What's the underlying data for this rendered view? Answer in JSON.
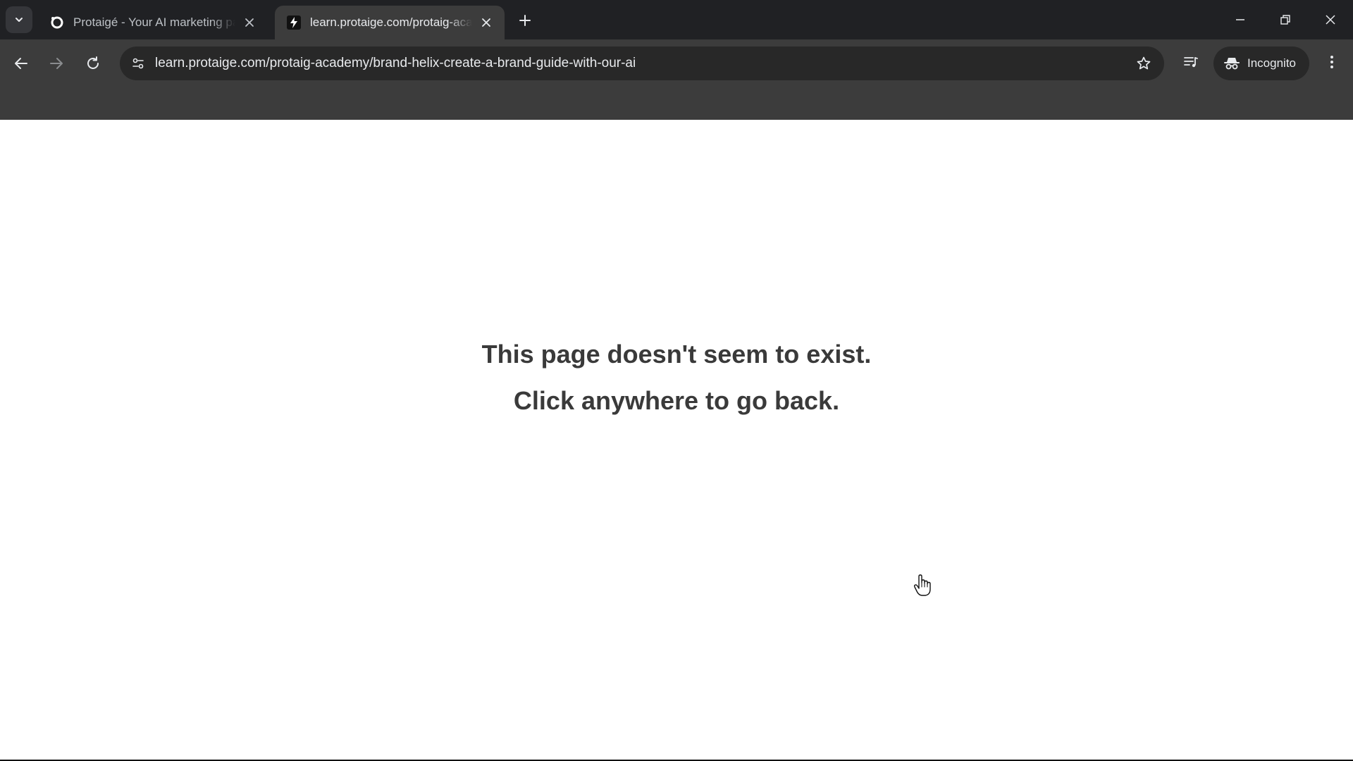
{
  "browser": {
    "tabs": [
      {
        "title": "Protaigé - Your AI marketing pa",
        "favicon": "protaige-ring-icon",
        "active": false
      },
      {
        "title": "learn.protaige.com/protaig-aca",
        "favicon": "lightning-bolt-icon",
        "active": true
      }
    ],
    "address_bar": {
      "url": "learn.protaige.com/protaig-academy/brand-helix-create-a-brand-guide-with-our-ai"
    },
    "incognito_label": "Incognito",
    "colors": {
      "tabstrip": "#202124",
      "toolbar": "#3c3c3c",
      "omnibox": "#282828",
      "text": "#e8eaed"
    }
  },
  "page": {
    "message_line1": "This page doesn't seem to exist.",
    "message_line2": "Click anywhere to go back.",
    "text_color": "#3a3a3a"
  }
}
